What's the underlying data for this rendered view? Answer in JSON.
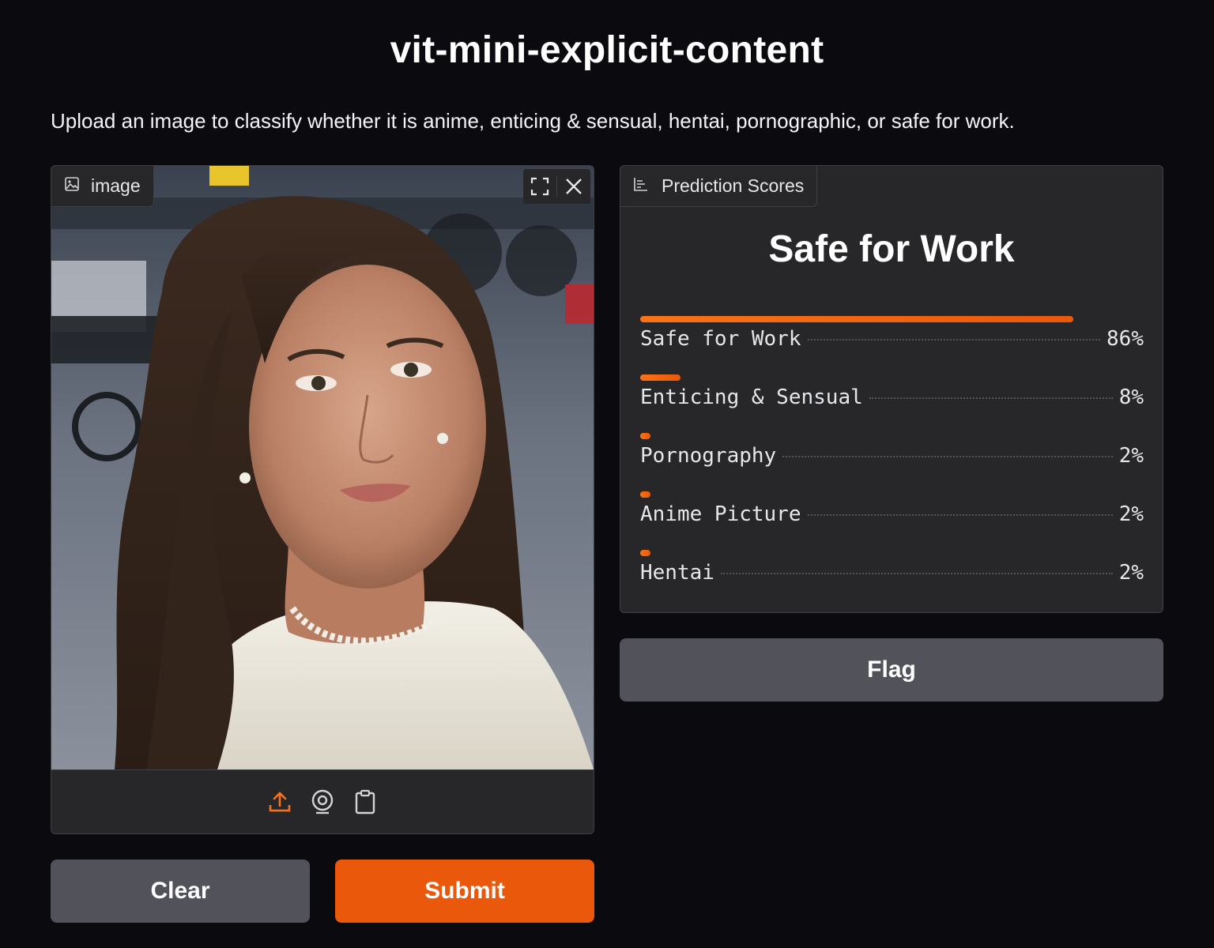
{
  "header": {
    "title": "vit-mini-explicit-content",
    "description": "Upload an image to classify whether it is anime, enticing & sensual, hentai, pornographic, or safe for work."
  },
  "image_input": {
    "label": "image",
    "icons": [
      "image-icon",
      "fullscreen-icon",
      "close-icon",
      "upload-icon",
      "webcam-icon",
      "clipboard-icon"
    ]
  },
  "buttons": {
    "clear": "Clear",
    "submit": "Submit",
    "flag": "Flag"
  },
  "prediction": {
    "label": "Prediction Scores",
    "top_label": "Safe for Work",
    "scores": [
      {
        "name": "Safe for Work",
        "value": "86%",
        "fraction": 0.86
      },
      {
        "name": "Enticing & Sensual",
        "value": "8%",
        "fraction": 0.08
      },
      {
        "name": "Pornography",
        "value": "2%",
        "fraction": 0.02
      },
      {
        "name": "Anime Picture",
        "value": "2%",
        "fraction": 0.02
      },
      {
        "name": "Hentai",
        "value": "2%",
        "fraction": 0.02
      }
    ]
  },
  "colors": {
    "background": "#0b0b0f",
    "panel": "#27272a",
    "border": "#3f3f46",
    "accent": "#ea580c",
    "secondary_button": "#52525b"
  }
}
